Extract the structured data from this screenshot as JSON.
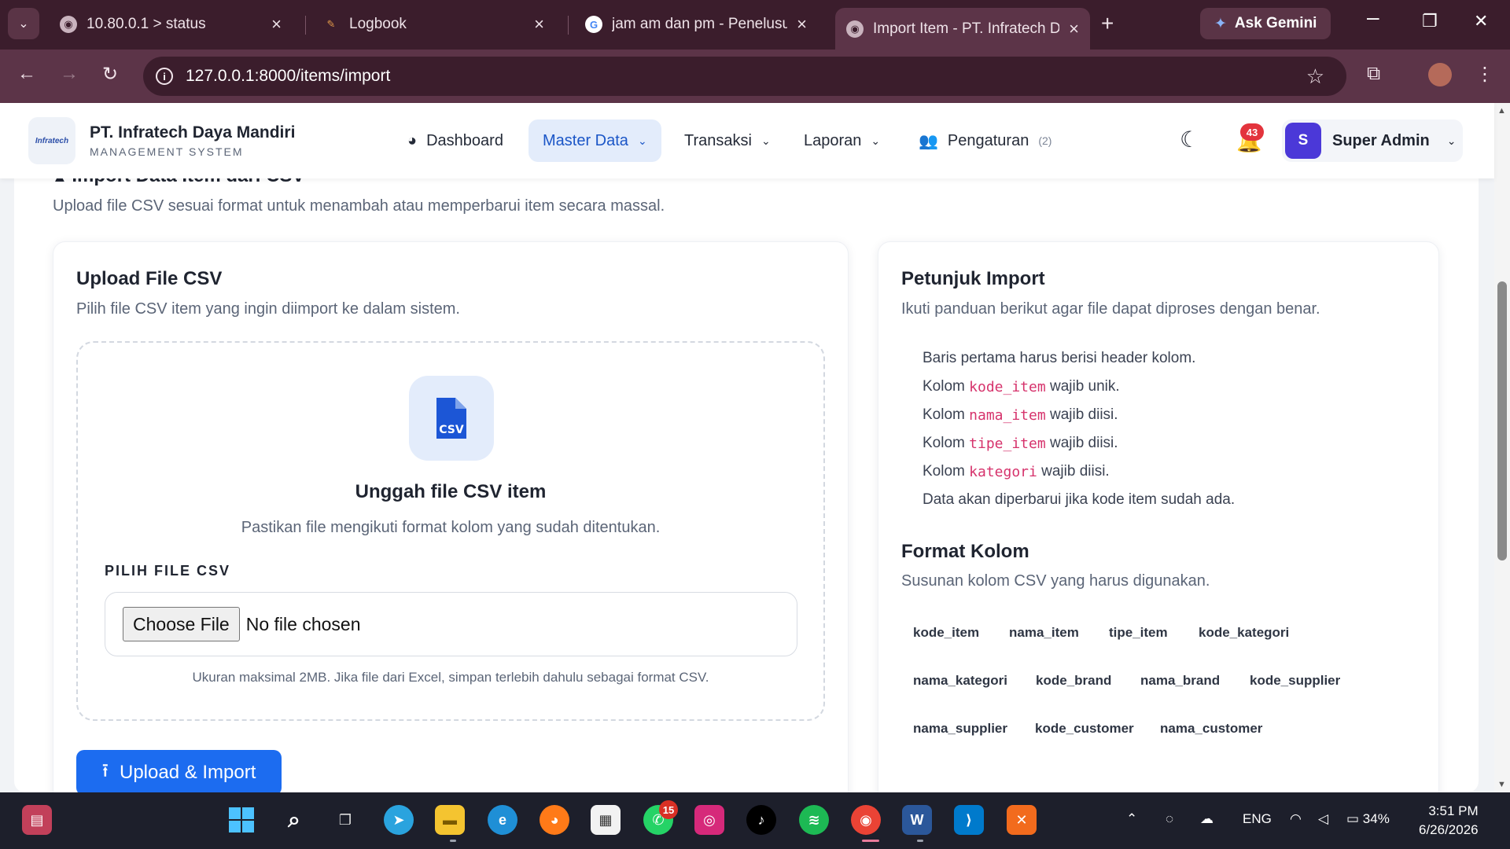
{
  "browser": {
    "tabs": [
      {
        "title": "10.80.0.1 > status"
      },
      {
        "title": "Logbook"
      },
      {
        "title": "jam am dan pm - Penelusura"
      },
      {
        "title": "Import Item - PT. Infratech D"
      }
    ],
    "gemini_label": "Ask Gemini",
    "url": "127.0.0.1:8000/items/import"
  },
  "app": {
    "logo_text": "Infratech",
    "brand_title": "PT. Infratech Daya Mandiri",
    "brand_subtitle": "MANAGEMENT SYSTEM",
    "nav": {
      "dashboard": "Dashboard",
      "master_data": "Master Data",
      "transaksi": "Transaksi",
      "laporan": "Laporan",
      "pengaturan": "Pengaturan",
      "pengaturan_count": "(2)"
    },
    "notification_count": "43",
    "user": {
      "initial": "S",
      "name": "Super Admin"
    }
  },
  "page": {
    "title": "Import Data Item dari CSV",
    "description": "Upload file CSV sesuai format untuk menambah atau memperbarui item secara massal."
  },
  "upload_card": {
    "title": "Upload File CSV",
    "description": "Pilih file CSV item yang ingin diimport ke dalam sistem.",
    "csv_icon_text": "CSV",
    "drop_title": "Unggah file CSV item",
    "drop_description": "Pastikan file mengikuti format kolom yang sudah ditentukan.",
    "file_label": "PILIH FILE CSV",
    "choose_button": "Choose File",
    "no_file_text": "No file chosen",
    "hint": "Ukuran maksimal 2MB. Jika file dari Excel, simpan terlebih dahulu sebagai format CSV.",
    "submit_label": "Upload & Import"
  },
  "guide_card": {
    "title": "Petunjuk Import",
    "description": "Ikuti panduan berikut agar file dapat diproses dengan benar.",
    "rules": [
      {
        "text": "Baris pertama harus berisi header kolom."
      },
      {
        "prefix": "Kolom ",
        "code": "kode_item",
        "suffix": " wajib unik."
      },
      {
        "prefix": "Kolom ",
        "code": "nama_item",
        "suffix": " wajib diisi."
      },
      {
        "prefix": "Kolom ",
        "code": "tipe_item",
        "suffix": " wajib diisi."
      },
      {
        "prefix": "Kolom ",
        "code": "kategori",
        "suffix": " wajib diisi."
      },
      {
        "text": "Data akan diperbarui jika kode item sudah ada."
      }
    ],
    "format_title": "Format Kolom",
    "format_description": "Susunan kolom CSV yang harus digunakan.",
    "columns": [
      "kode_item",
      "nama_item",
      "tipe_item",
      "kode_kategori",
      "nama_kategori",
      "kode_brand",
      "nama_brand",
      "kode_supplier",
      "nama_supplier",
      "kode_customer",
      "nama_customer"
    ]
  },
  "taskbar": {
    "whatsapp_badge": "15",
    "language": "ENG",
    "battery": "34%",
    "time": "3:51 PM",
    "date": "6/26/2026"
  },
  "colors": {
    "primary": "#1c6cf0",
    "browser_frame": "#3b1d2c",
    "code_pink": "#d6336c",
    "notification_red": "#e3343d"
  }
}
